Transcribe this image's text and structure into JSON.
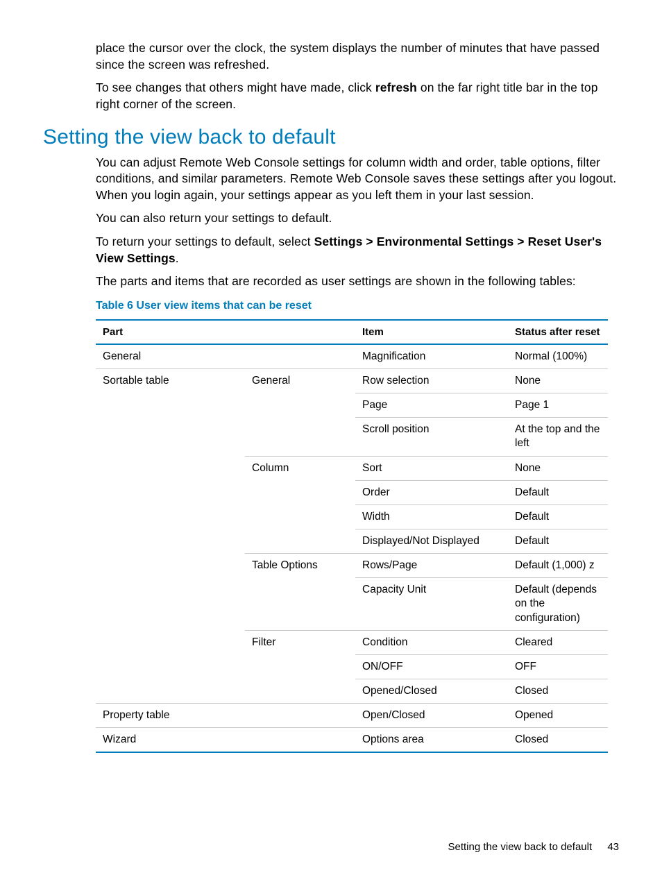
{
  "intro": {
    "p1": "place the cursor over the clock, the system displays the number of minutes that have passed since the screen was refreshed.",
    "p2a": "To see changes that others might have made, click ",
    "p2b": "refresh",
    "p2c": " on the far right title bar in the top right corner of the screen."
  },
  "section_heading": "Setting the view back to default",
  "section": {
    "p1": "You can adjust Remote Web Console settings for column width and order, table options, filter conditions, and similar parameters. Remote Web Console saves these settings after you logout. When you login again, your settings appear as you left them in your last session.",
    "p2": "You can also return your settings to default.",
    "p3a": "To return your settings to default, select ",
    "p3b": "Settings > Environmental Settings > Reset User's View Settings",
    "p3c": ".",
    "p4": "The parts and items that are recorded as user settings are shown in the following tables:"
  },
  "table_caption": "Table 6 User view items that can be reset",
  "table": {
    "headers": {
      "part": "Part",
      "item": "Item",
      "status": "Status after reset"
    },
    "rows": [
      {
        "part": "General",
        "sub": "",
        "item": "Magnification",
        "status": "Normal (100%)"
      },
      {
        "part": "Sortable table",
        "sub": "General",
        "item": "Row selection",
        "status": "None"
      },
      {
        "part": "",
        "sub": "",
        "item": "Page",
        "status": "Page 1"
      },
      {
        "part": "",
        "sub": "",
        "item": "Scroll position",
        "status": "At the top and the left"
      },
      {
        "part": "",
        "sub": "Column",
        "item": "Sort",
        "status": "None"
      },
      {
        "part": "",
        "sub": "",
        "item": "Order",
        "status": "Default"
      },
      {
        "part": "",
        "sub": "",
        "item": "Width",
        "status": "Default"
      },
      {
        "part": "",
        "sub": "",
        "item": "Displayed/Not Displayed",
        "status": "Default"
      },
      {
        "part": "",
        "sub": "Table Options",
        "item": "Rows/Page",
        "status": "Default (1,000) z"
      },
      {
        "part": "",
        "sub": "",
        "item": "Capacity Unit",
        "status": "Default (depends on the configuration)"
      },
      {
        "part": "",
        "sub": "Filter",
        "item": "Condition",
        "status": "Cleared"
      },
      {
        "part": "",
        "sub": "",
        "item": "ON/OFF",
        "status": "OFF"
      },
      {
        "part": "",
        "sub": "",
        "item": "Opened/Closed",
        "status": "Closed"
      },
      {
        "part": "Property table",
        "sub": "",
        "item": "Open/Closed",
        "status": "Opened"
      },
      {
        "part": "Wizard",
        "sub": "",
        "item": "Options area",
        "status": "Closed"
      }
    ]
  },
  "footer": {
    "text": "Setting the view back to default",
    "page_number": "43"
  }
}
